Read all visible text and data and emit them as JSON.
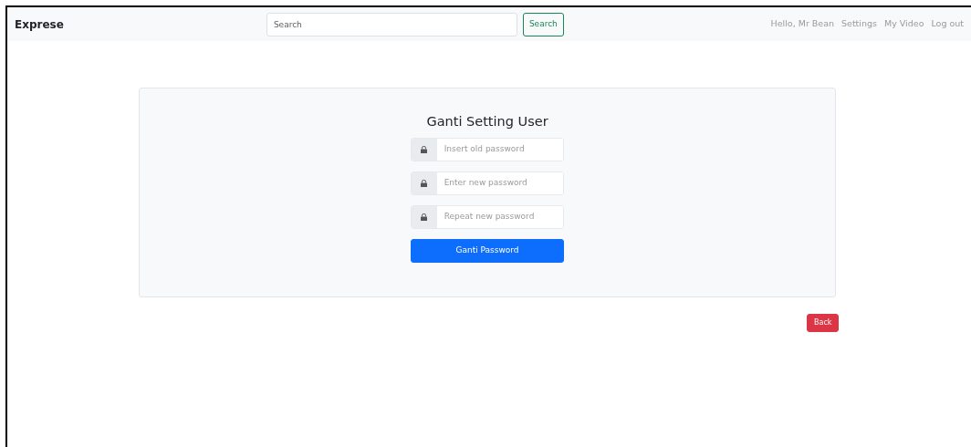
{
  "navbar": {
    "brand": "Exprese",
    "search": {
      "placeholder": "Search",
      "button": "Search"
    },
    "links": [
      "Hello, Mr Bean",
      "Settings",
      "My Video",
      "Log out"
    ]
  },
  "form": {
    "title": "Ganti Setting User",
    "fields": [
      {
        "placeholder": "Insert old password"
      },
      {
        "placeholder": "Enter new password"
      },
      {
        "placeholder": "Repeat new password"
      }
    ],
    "submit": "Ganti Password"
  },
  "back_button": "Back"
}
